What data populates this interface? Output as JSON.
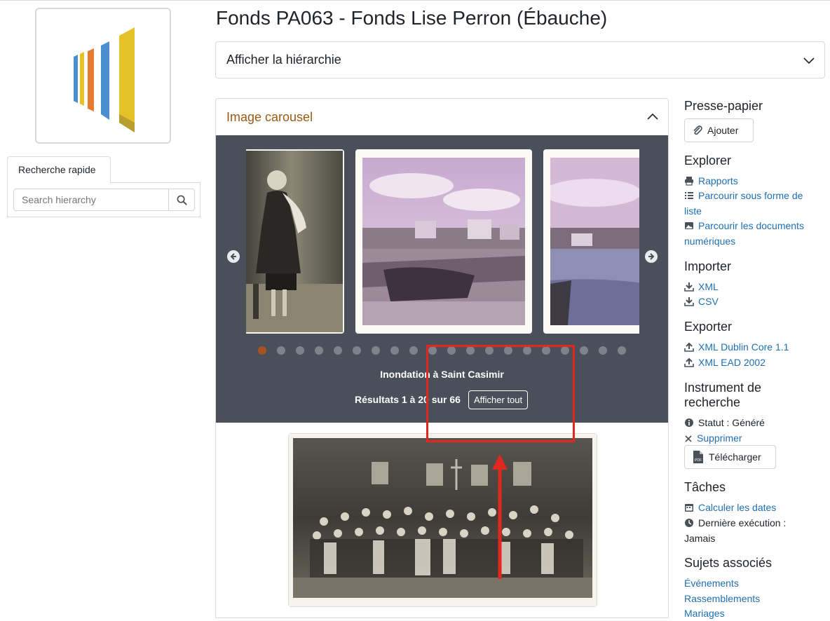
{
  "page": {
    "title": "Fonds PA063 - Fonds Lise Perron (Ébauche)"
  },
  "quick_search": {
    "tab_label": "Recherche rapide",
    "placeholder": "Search hierarchy"
  },
  "hierarchy": {
    "label": "Afficher la hiérarchie"
  },
  "carousel": {
    "header": "Image carousel",
    "caption": "Inondation à Saint Casimir",
    "results": "Résultats 1 à 20 sur 66",
    "show_all": "Afficher tout",
    "dots_total": 20,
    "active_dot": 0
  },
  "sidebar": {
    "clipboard": {
      "heading": "Presse-papier",
      "add_label": "Ajouter"
    },
    "explore": {
      "heading": "Explorer",
      "reports": "Rapports",
      "browse_list_line1": "Parcourir sous forme de",
      "browse_list_line2": "liste",
      "browse_digital_line1": "Parcourir les documents",
      "browse_digital_line2": "numériques"
    },
    "import": {
      "heading": "Importer",
      "xml": "XML",
      "csv": "CSV"
    },
    "export": {
      "heading": "Exporter",
      "dc": "XML Dublin Core 1.1",
      "ead": "XML EAD 2002"
    },
    "finding_aid": {
      "heading_line1": "Instrument de",
      "heading_line2": "recherche",
      "status": "Statut : Généré",
      "delete": "Supprimer",
      "download": "Télécharger"
    },
    "tasks": {
      "heading": "Tâches",
      "calc_dates": "Calculer les dates",
      "last_run": "Dernière exécution :",
      "last_run_value": "Jamais"
    },
    "subjects": {
      "heading": "Sujets associés",
      "items": [
        "Événements",
        "Rassemblements",
        "Mariages"
      ]
    }
  },
  "colors": {
    "accent_header": "#9a5a14",
    "link": "#1f6fb2",
    "carousel_bg": "#495059",
    "active_dot": "#a8531f",
    "annotation_red": "#e3261f"
  }
}
